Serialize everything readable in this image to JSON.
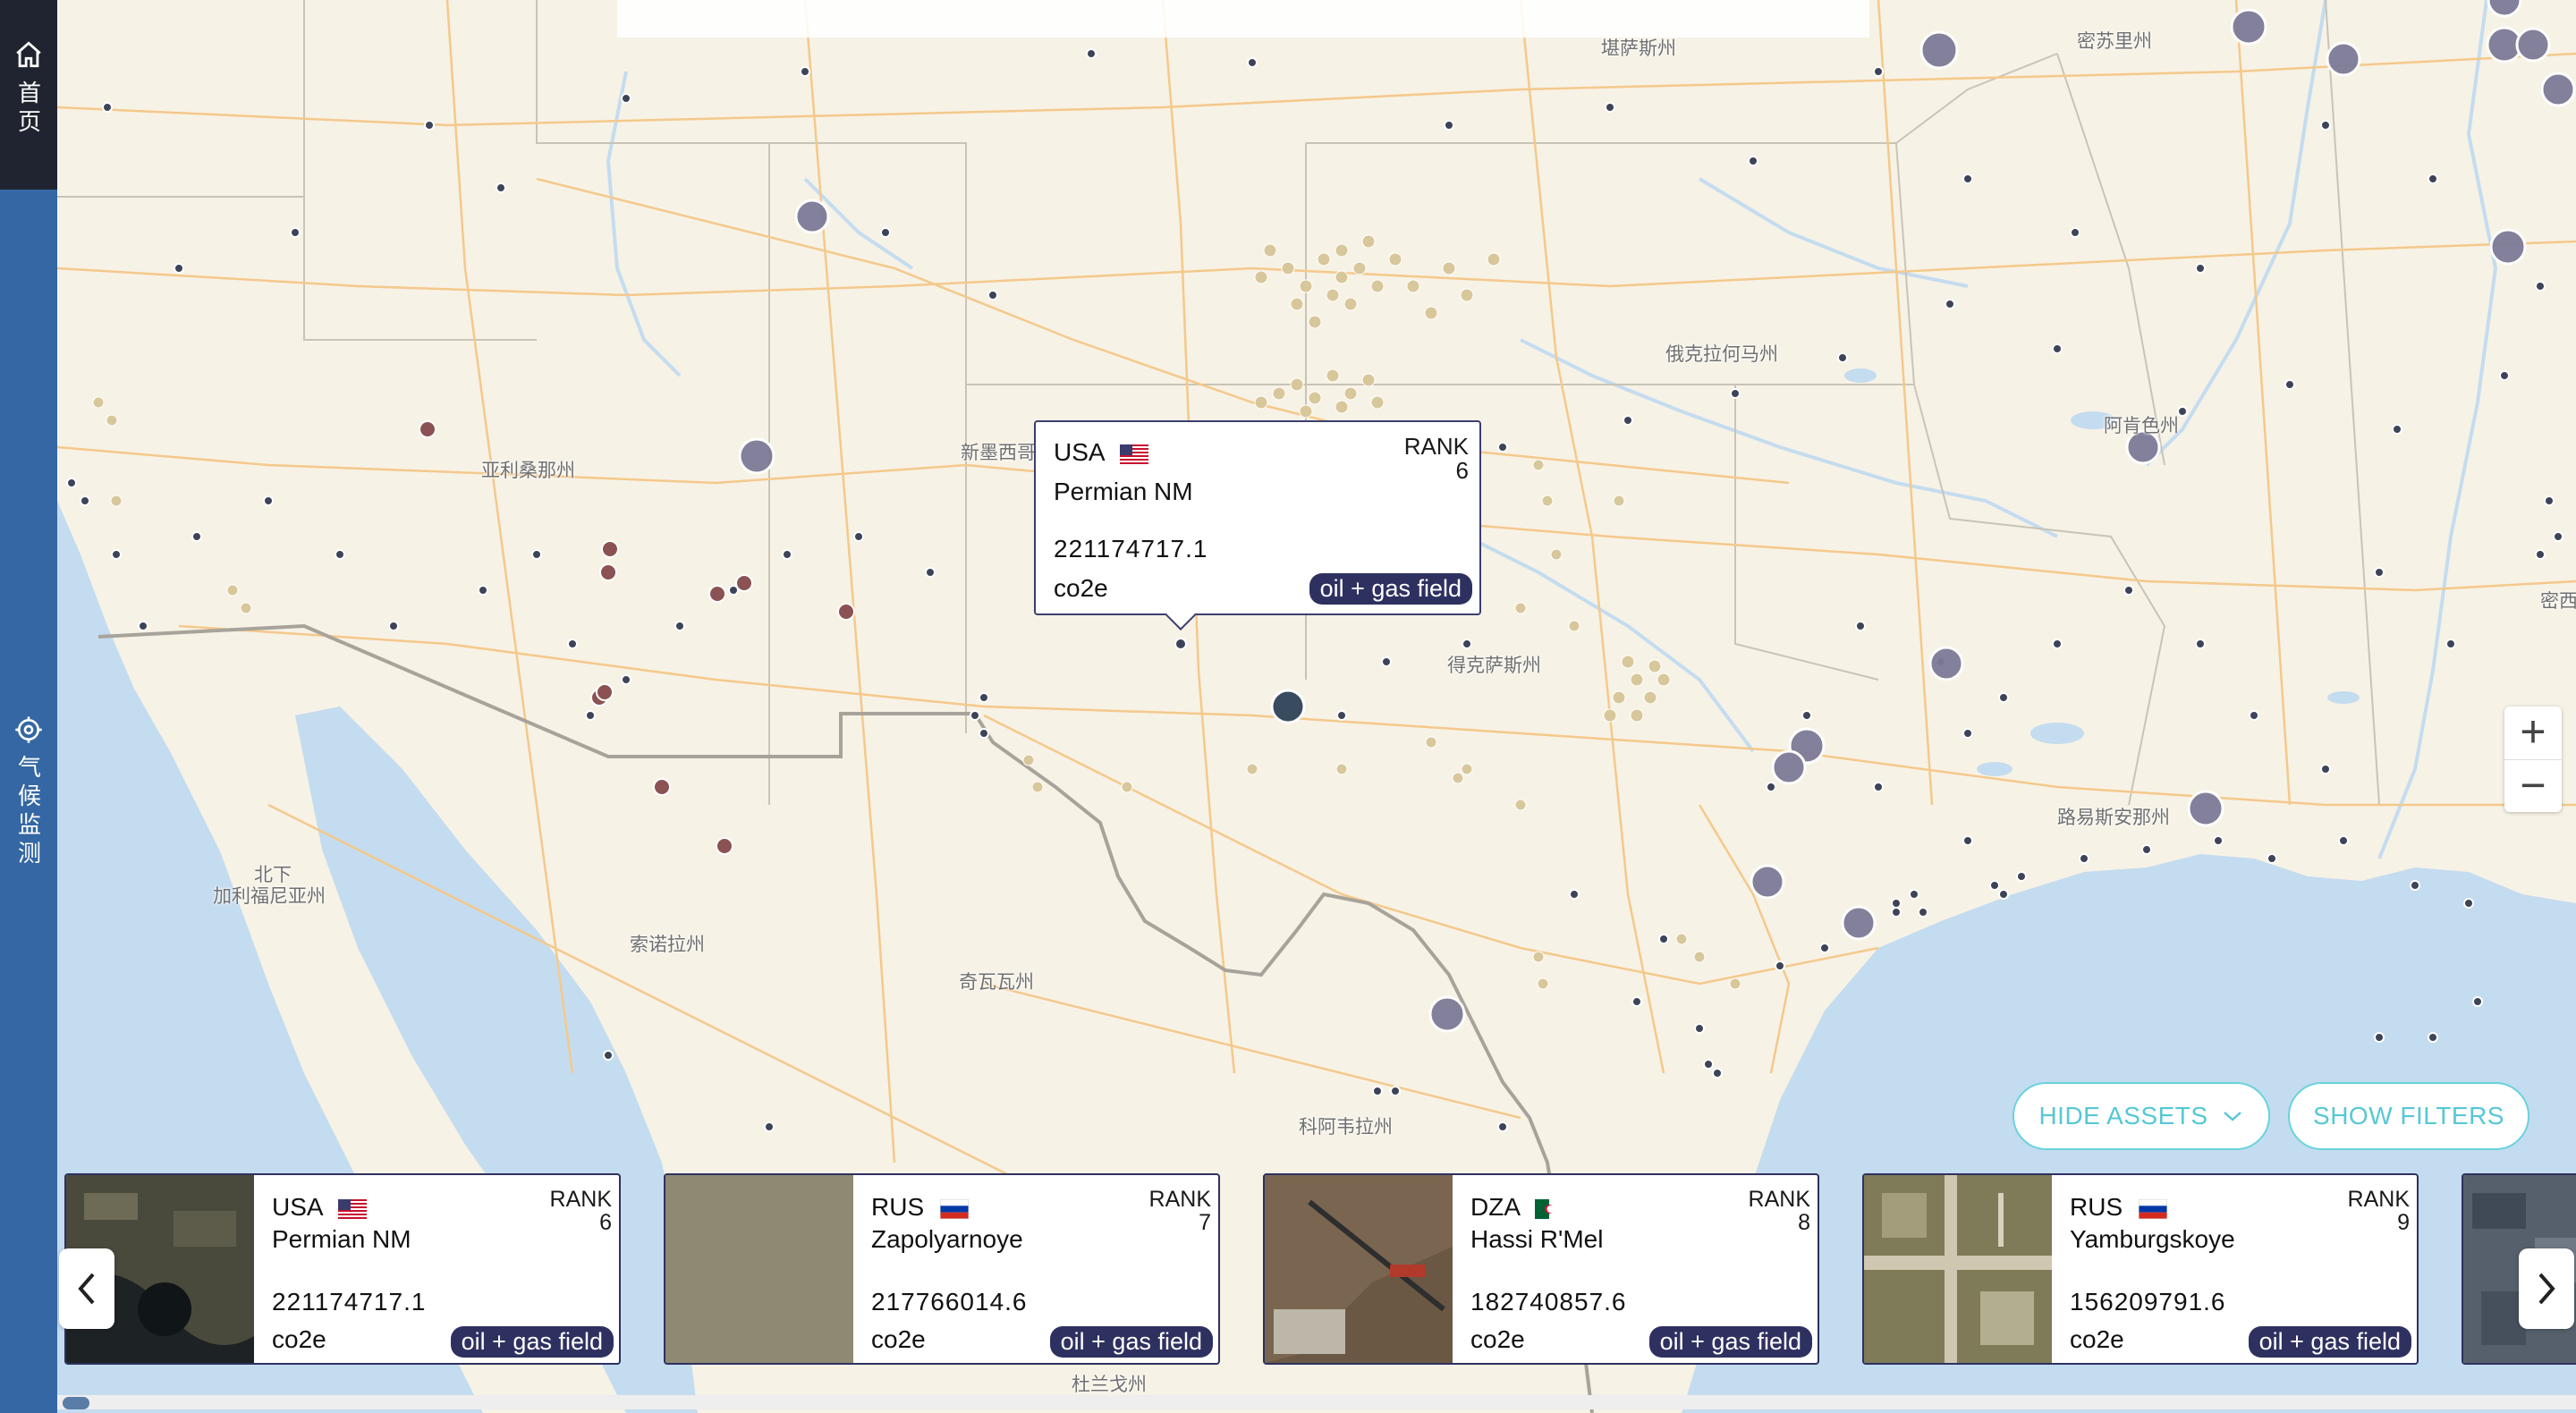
{
  "sidebar": {
    "home_label": "首页",
    "climate_label": "气候监测"
  },
  "map": {
    "labels": [
      {
        "id": "kansas",
        "text": "堪萨斯州"
      },
      {
        "id": "missouri",
        "text": "密苏里州"
      },
      {
        "id": "oklahoma",
        "text": "俄克拉何马州"
      },
      {
        "id": "arkansas",
        "text": "阿肯色州"
      },
      {
        "id": "arizona",
        "text": "亚利桑那州"
      },
      {
        "id": "newmexico",
        "text": "新墨西哥州"
      },
      {
        "id": "texas",
        "text": "得克萨斯州"
      },
      {
        "id": "louisiana",
        "text": "路易斯安那州"
      },
      {
        "id": "bcn1",
        "text": "北下"
      },
      {
        "id": "bcn2",
        "text": "加利福尼亚州"
      },
      {
        "id": "sonora",
        "text": "索诺拉州"
      },
      {
        "id": "chihuahua",
        "text": "奇瓦瓦州"
      },
      {
        "id": "coahuila",
        "text": "科阿韦拉州"
      },
      {
        "id": "durango",
        "text": "杜兰戈州"
      },
      {
        "id": "mississippi_cut",
        "text": "密西"
      }
    ]
  },
  "popup": {
    "country": "USA",
    "name": "Permian NM",
    "rank_label": "RANK",
    "rank": "6",
    "value": "221174717.1",
    "unit": "co2e",
    "type": "oil + gas field"
  },
  "controls": {
    "zoom_in": "+",
    "zoom_out": "−",
    "hide_assets": "HIDE ASSETS",
    "show_filters": "SHOW FILTERS"
  },
  "cards": [
    {
      "country": "USA",
      "flag": "us",
      "name": "Permian NM",
      "rank_label": "RANK",
      "rank": "6",
      "value": "221174717.1",
      "unit": "co2e",
      "type": "oil + gas field"
    },
    {
      "country": "RUS",
      "flag": "ru",
      "name": "Zapolyarnoye",
      "rank_label": "RANK",
      "rank": "7",
      "value": "217766014.6",
      "unit": "co2e",
      "type": "oil + gas field"
    },
    {
      "country": "DZA",
      "flag": "dz",
      "name": "Hassi R'Mel",
      "rank_label": "RANK",
      "rank": "8",
      "value": "182740857.6",
      "unit": "co2e",
      "type": "oil + gas field"
    },
    {
      "country": "RUS",
      "flag": "ru",
      "name": "Yamburgskoye",
      "rank_label": "RANK",
      "rank": "9",
      "value": "156209791.6",
      "unit": "co2e",
      "type": "oil + gas field"
    }
  ],
  "colors": {
    "sidebar": "#3467a3",
    "sidebar_home": "#1f2430",
    "pill": "#2e3160",
    "accent": "#56c8d5",
    "land": "#f7f2e6",
    "water": "#c4dcef",
    "road": "#f4c98b"
  }
}
